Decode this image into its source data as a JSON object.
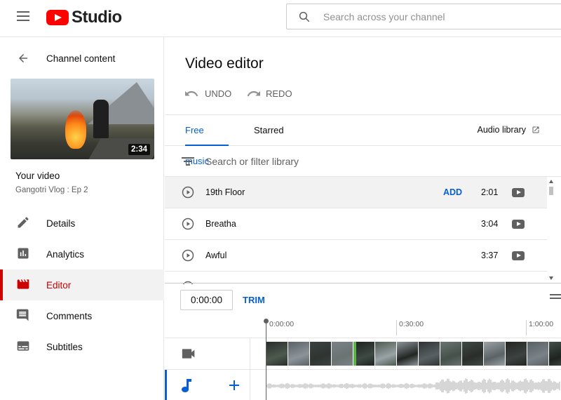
{
  "app": {
    "name": "Studio"
  },
  "search": {
    "placeholder": "Search across your channel"
  },
  "sidebar": {
    "back_label": "Channel content",
    "thumbnail_duration": "2:34",
    "your_video_label": "Your video",
    "video_title": "Gangotri Vlog : Ep 2",
    "items": [
      {
        "label": "Details",
        "icon": "pencil-icon",
        "active": false
      },
      {
        "label": "Analytics",
        "icon": "analytics-icon",
        "active": false
      },
      {
        "label": "Editor",
        "icon": "editor-clapper-icon",
        "active": true
      },
      {
        "label": "Comments",
        "icon": "comments-icon",
        "active": false
      },
      {
        "label": "Subtitles",
        "icon": "subtitles-icon",
        "active": false
      }
    ]
  },
  "editor": {
    "title": "Video editor",
    "undo_label": "UNDO",
    "redo_label": "REDO",
    "tabs": [
      {
        "label": "Free music",
        "active": true
      },
      {
        "label": "Starred",
        "active": false
      }
    ],
    "audio_library_label": "Audio library",
    "filter_placeholder": "Search or filter library",
    "tracks": [
      {
        "name": "19th Floor",
        "duration": "2:01",
        "action": "ADD",
        "hover": true
      },
      {
        "name": "Breatha",
        "duration": "3:04"
      },
      {
        "name": "Awful",
        "duration": "3:37"
      }
    ]
  },
  "timeline": {
    "current_time": "0:00:00",
    "trim_label": "TRIM",
    "ruler_ticks": [
      "0:00:00",
      "0:30:00",
      "1:00:00"
    ]
  },
  "colors": {
    "accent_blue": "#065fd4",
    "active_red": "#cc0000",
    "logo_red": "#ff0000"
  }
}
